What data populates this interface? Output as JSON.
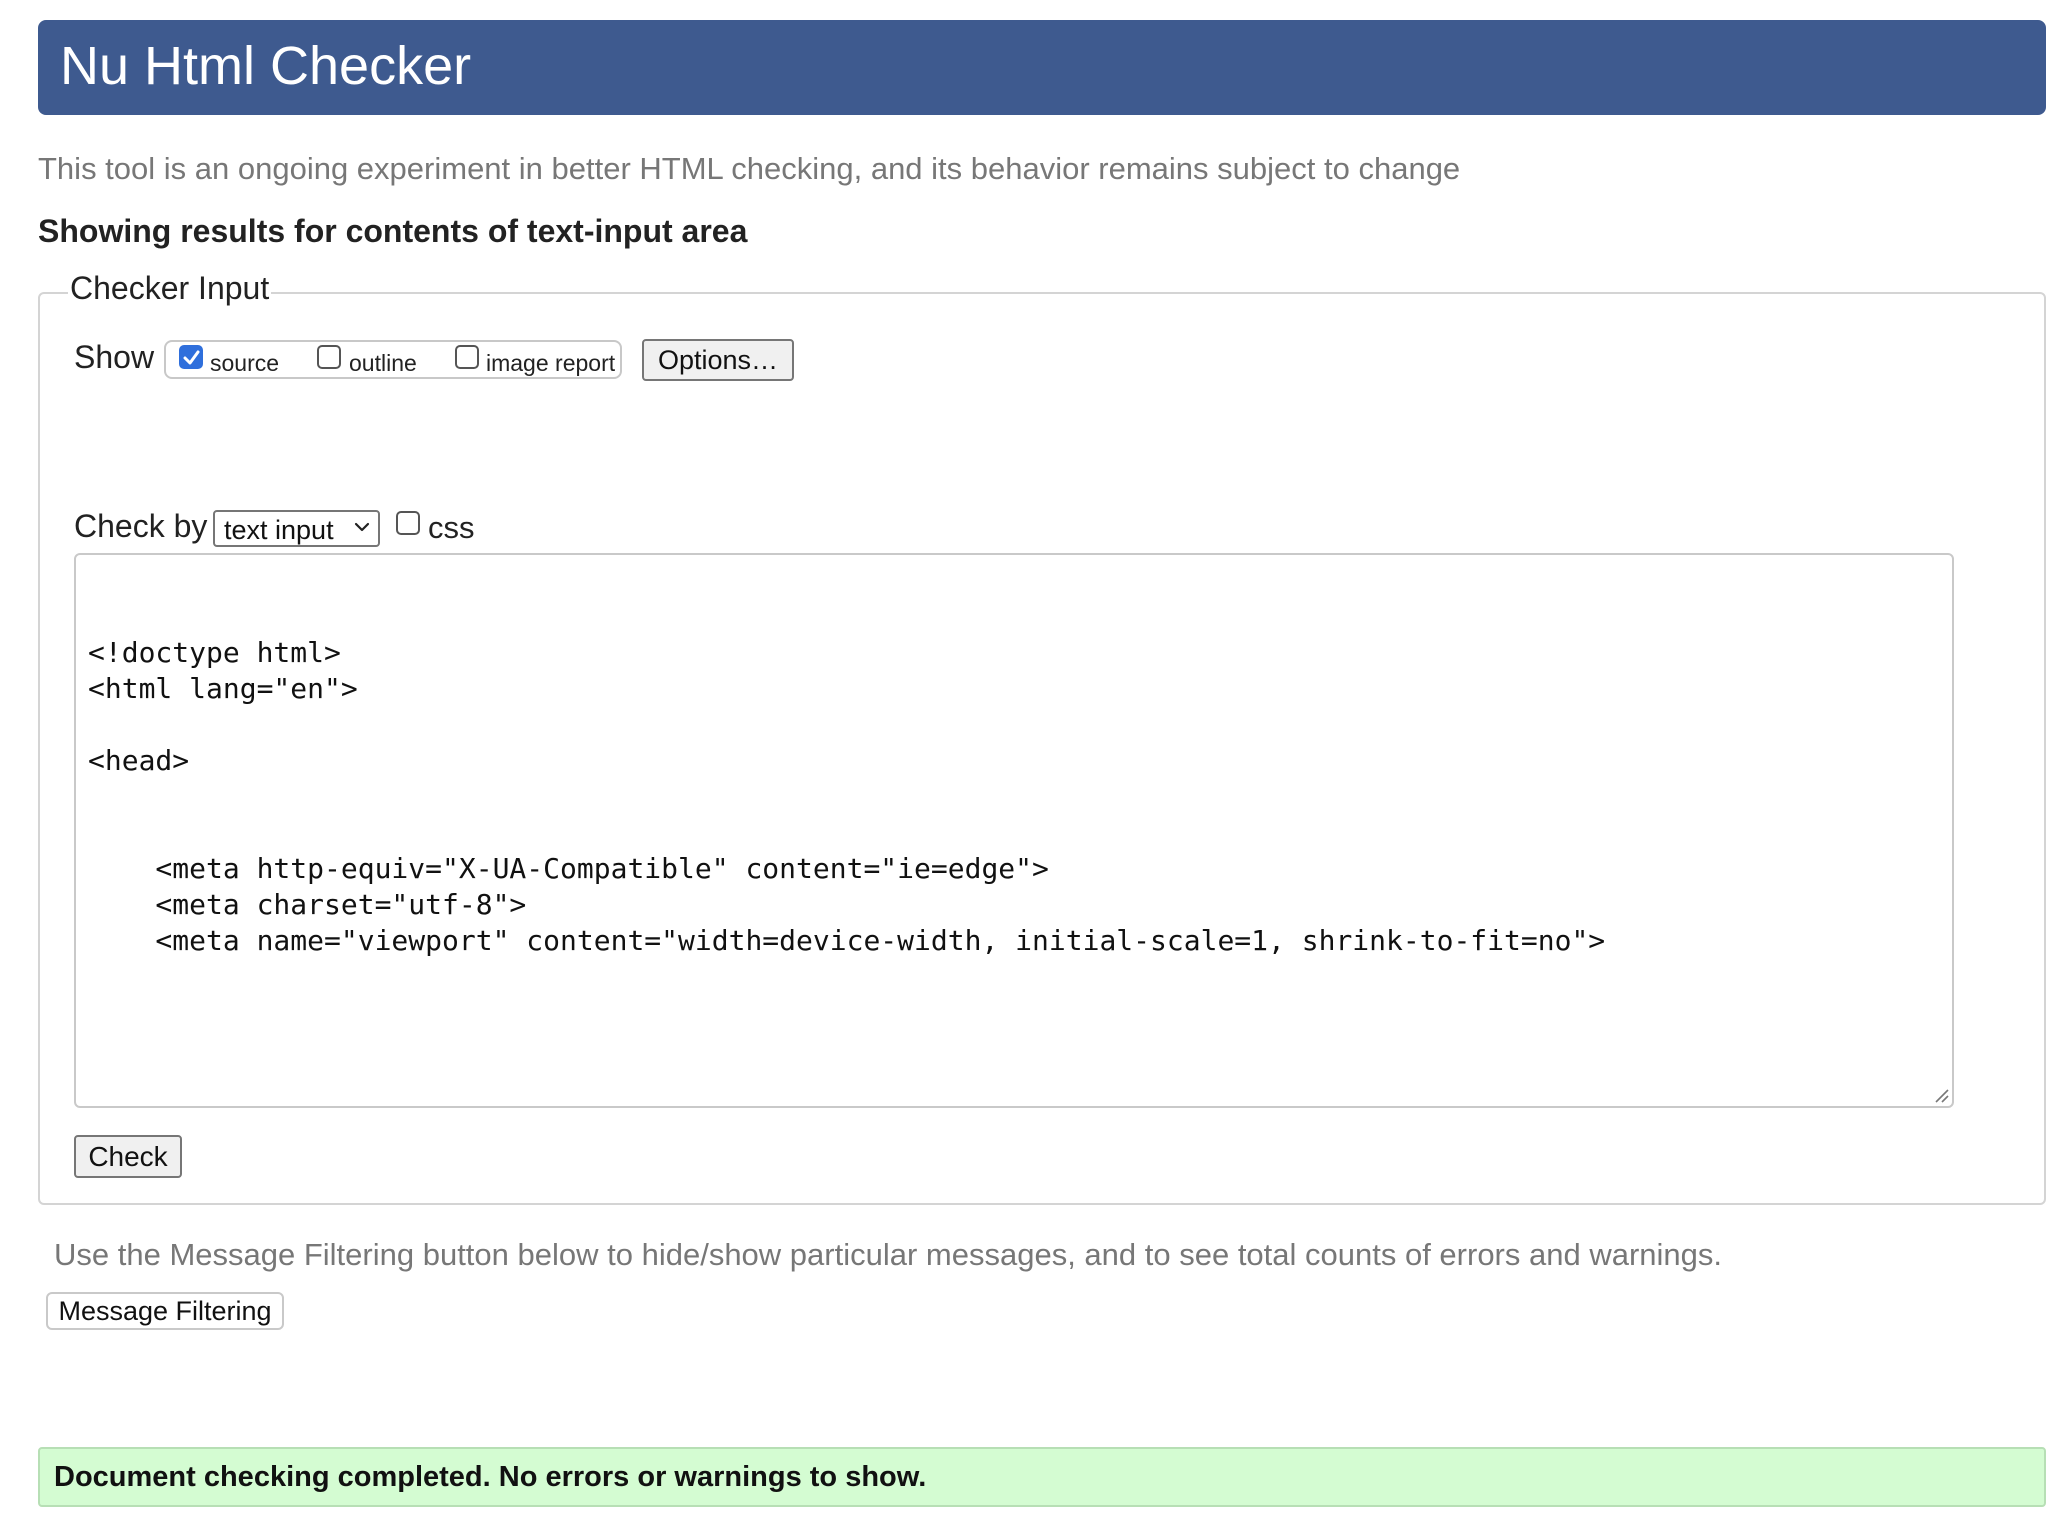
{
  "header": {
    "title": "Nu Html Checker"
  },
  "tagline": "This tool is an ongoing experiment in better HTML checking, and its behavior remains subject to change",
  "results_heading": "Showing results for contents of text-input area",
  "checker_input": {
    "legend": "Checker Input",
    "show_label": "Show",
    "show_options": [
      {
        "label": "source",
        "checked": true
      },
      {
        "label": "outline",
        "checked": false
      },
      {
        "label": "image report",
        "checked": false
      }
    ],
    "options_button": "Options…",
    "check_by_label": "Check by",
    "check_by_selected": "text input",
    "css_label": "css",
    "css_checked": false,
    "source_text": "\n<!doctype html>\n<html lang=\"en\">\n\n<head>\n\n\n    <meta http-equiv=\"X-UA-Compatible\" content=\"ie=edge\">\n    <meta charset=\"utf-8\">\n    <meta name=\"viewport\" content=\"width=device-width, initial-scale=1, shrink-to-fit=no\">",
    "check_button": "Check"
  },
  "filter_note": "Use the Message Filtering button below to hide/show particular messages, and to see total counts of errors and warnings.",
  "filter_button": "Message Filtering",
  "success_message": "Document checking completed. No errors or warnings to show.",
  "colors": {
    "header_bg": "#3e5a8f",
    "success_bg": "#d4fcd2",
    "checkbox_accent": "#2f6fdc"
  }
}
